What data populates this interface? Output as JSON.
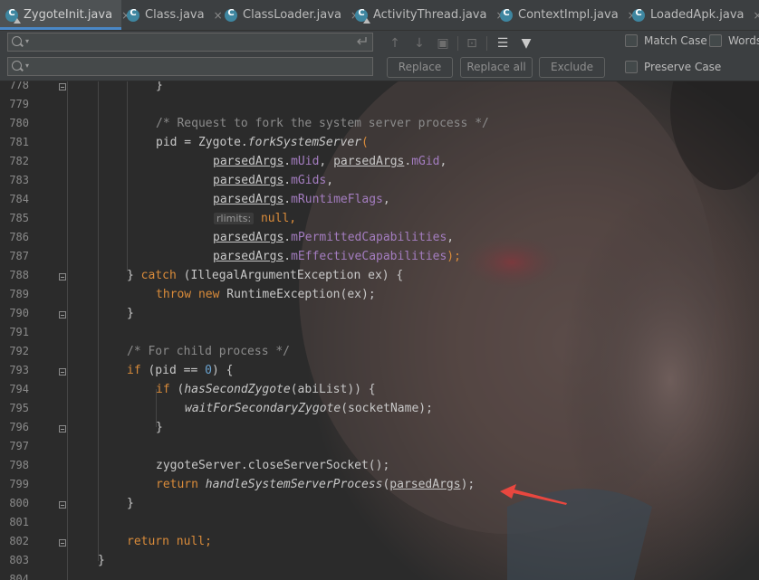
{
  "tabs": [
    {
      "label": "ZygoteInit.java",
      "active": true
    },
    {
      "label": "Class.java"
    },
    {
      "label": "ClassLoader.java"
    },
    {
      "label": "ActivityThread.java"
    },
    {
      "label": "ContextImpl.java"
    },
    {
      "label": "LoadedApk.java"
    }
  ],
  "tab_close": "×",
  "search": {
    "find_value": "",
    "replace_value": ""
  },
  "options": {
    "match_case": "Match Case",
    "words": "Words",
    "preserve_case": "Preserve Case"
  },
  "buttons": {
    "replace": "Replace",
    "replace_all": "Replace all",
    "exclude": "Exclude"
  },
  "editor": {
    "line_numbers": [
      "778",
      "779",
      "780",
      "781",
      "782",
      "783",
      "784",
      "785",
      "786",
      "787",
      "788",
      "789",
      "790",
      "791",
      "792",
      "793",
      "794",
      "795",
      "796",
      "797",
      "798",
      "799",
      "800",
      "801",
      "802",
      "803",
      "804"
    ],
    "lines": {
      "l778": "}",
      "l780": "/* Request to fork the system server process */",
      "l781a": "pid = Zygote.",
      "l781b": "forkSystemServer",
      "l781c": "(",
      "parsed": "parsedArgs",
      "dot": ".",
      "muid": "mUid",
      "mgid": "mGid",
      "mgids": "mGids",
      "mrtflags": "mRuntimeFlags",
      "rlimits": "rlimits:",
      "null_comma": "null,",
      "mpermcap": "mPermittedCapabilities",
      "meffcap": "mEffectiveCapabilities",
      "comma": ",",
      "comma_sp": ", ",
      "close_semi": ");",
      "l788a": "} ",
      "catch": "catch",
      "l788b": " (IllegalArgumentException ex) {",
      "throw": "throw",
      "new": "new",
      "l789b": " RuntimeException(ex);",
      "l792": "/* For child process */",
      "if": "if",
      "l793a": " (pid == ",
      "zero": "0",
      "l793b": ") {",
      "l794a": " (",
      "hasSecond": "hasSecondZygote",
      "l794b": "(abiList)) {",
      "waitFor": "waitForSecondaryZygote",
      "l795b": "(socketName);",
      "l798": "zygoteServer.closeServerSocket();",
      "return": "return",
      "handle": "handleSystemServerProcess",
      "open": "(",
      "l803b": " null;",
      "brace": "}"
    }
  },
  "annotation_color": "#e8473f"
}
